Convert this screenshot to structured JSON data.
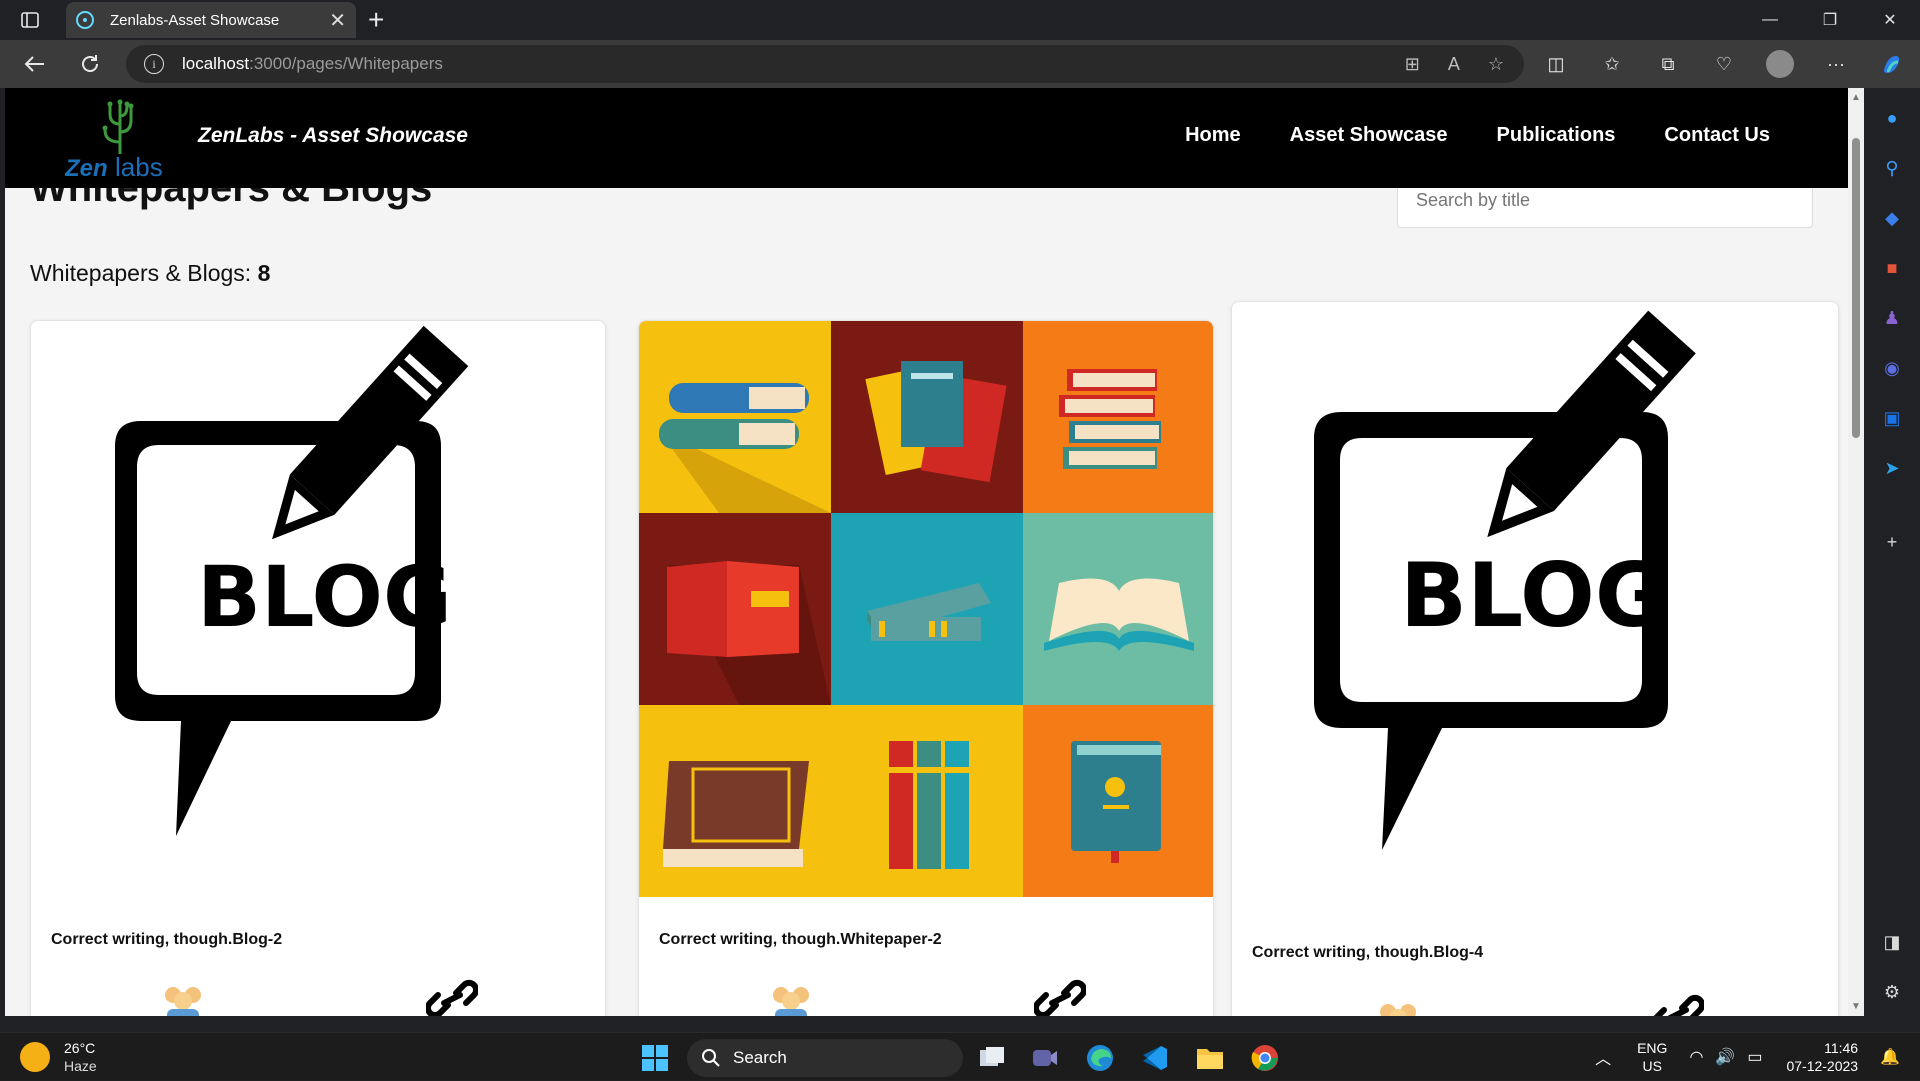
{
  "browser": {
    "tab_title": "Zenlabs-Asset Showcase",
    "tab_close": "✕",
    "new_tab": "+",
    "url_host": "localhost",
    "url_path": ":3000/pages/Whitepapers",
    "window_controls": {
      "minimize": "—",
      "restore": "❐",
      "close": "✕"
    }
  },
  "site": {
    "brand": "ZenLabs - Asset Showcase",
    "logo_text_zen": "Zen",
    "logo_text_labs": "labs",
    "menu": [
      "Home",
      "Asset Showcase",
      "Publications",
      "Contact Us"
    ]
  },
  "page": {
    "title": "Whitepapers & Blogs",
    "search_placeholder": "Search by title",
    "count_label": "Whitepapers & Blogs: ",
    "count_value": "8"
  },
  "cards": [
    {
      "title": "Correct writing, though.Blog-2",
      "image": "blog-icon"
    },
    {
      "title": "Correct writing, though.Whitepaper-2",
      "image": "books-collage"
    },
    {
      "title": "Correct writing, though.Blog-4",
      "image": "blog-icon"
    }
  ],
  "blog_image_text": "BLOG",
  "taskbar": {
    "temperature": "26°C",
    "weather": "Haze",
    "search": "Search",
    "lang_top": "ENG",
    "lang_bottom": "US",
    "time": "11:46",
    "date": "07-12-2023"
  },
  "colors": {
    "header_bg": "#000000",
    "page_bg": "#f4f4f4",
    "logo_blue": "#1b6fb8",
    "logo_green": "#3e9a3e"
  }
}
